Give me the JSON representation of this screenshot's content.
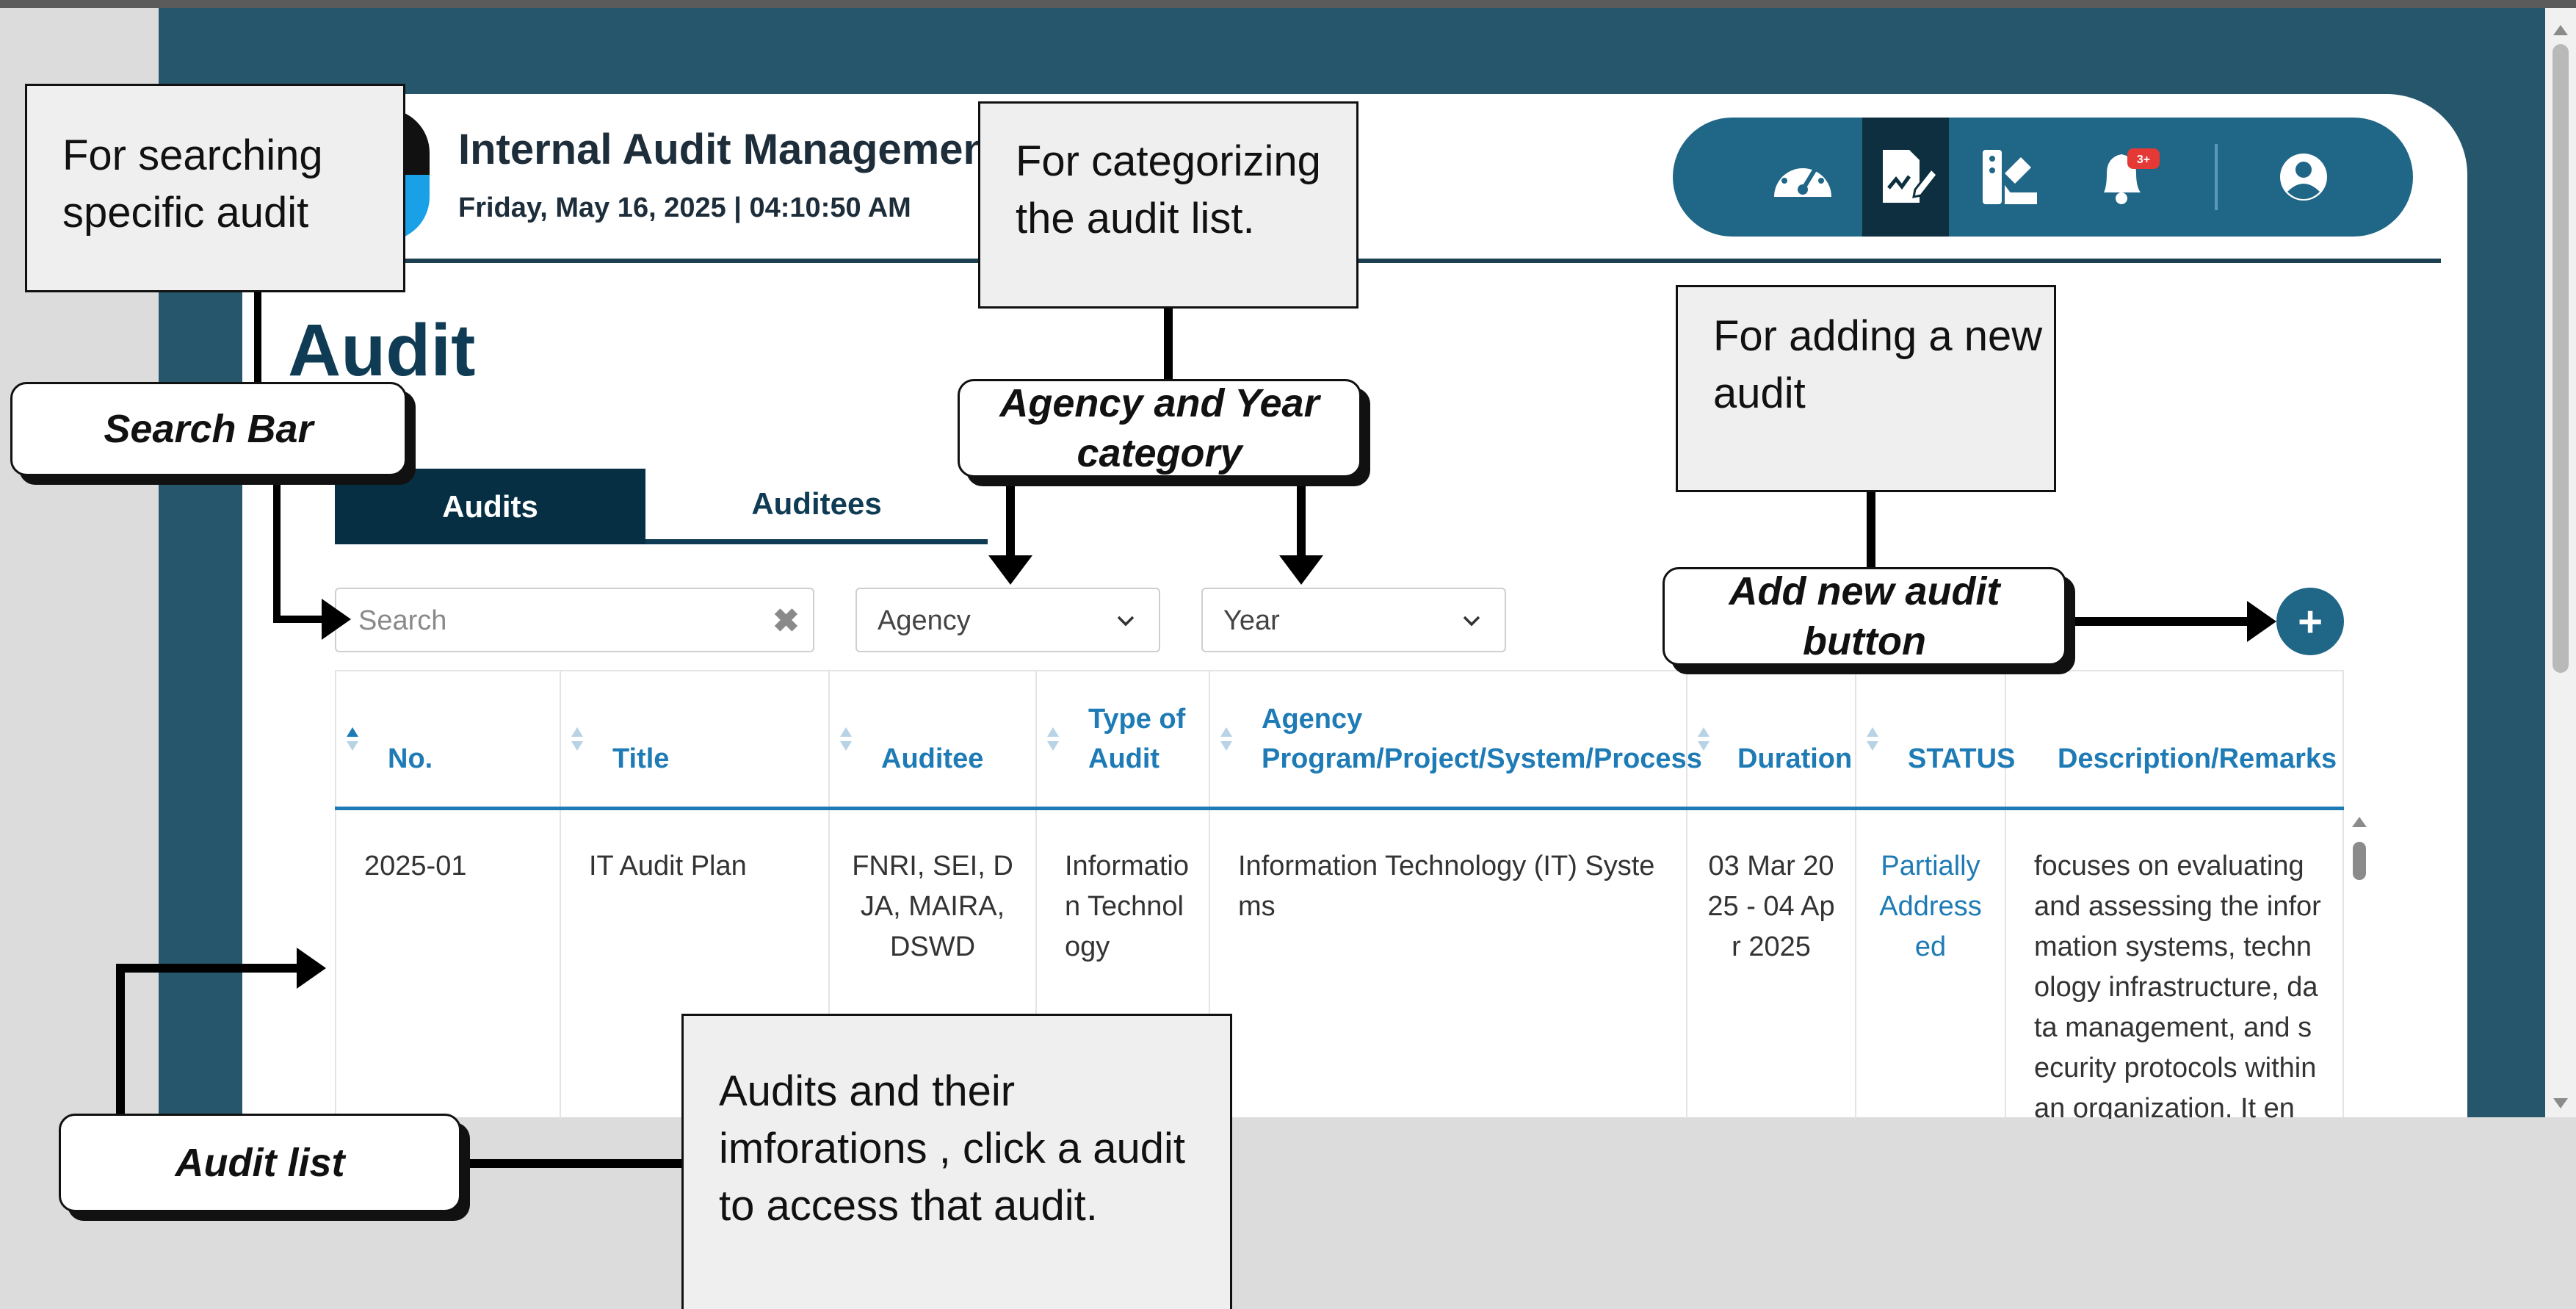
{
  "header": {
    "app_title": "Internal Audit Managemen",
    "date_time": "Friday, May 16, 2025 | 04:10:50 AM",
    "nav_icons": [
      "dashboard-icon",
      "audit-edit-icon",
      "reports-icon",
      "notification-bell-icon",
      "user-account-icon"
    ],
    "notification_badge": "3+"
  },
  "page": {
    "heading": "Audit"
  },
  "tabs": [
    {
      "label": "Audits",
      "active": true
    },
    {
      "label": "Auditees",
      "active": false
    }
  ],
  "filters": {
    "search_placeholder": "Search",
    "agency_label": "Agency",
    "year_label": "Year",
    "add_label": "+"
  },
  "table": {
    "columns": [
      "No.",
      "Title",
      "Auditee",
      "Type of Audit",
      "Agency Program/Project/System/Process",
      "Duration",
      "STATUS",
      "Description/Remarks"
    ],
    "rows": [
      {
        "no": "2025-01",
        "title": "IT Audit Plan",
        "auditee": "FNRI, SEI, DJA, MAIRA, DSWD",
        "type": "Information Technology",
        "agency_program": "Information Technology (IT) Systems",
        "duration": "03 Mar 2025 - 04 Apr 2025",
        "status": "Partially Addressed",
        "description": "focuses on evaluating and assessing the information systems, technology infrastructure, data management, and security protocols within an organization. It en"
      }
    ]
  },
  "annotations": {
    "search_note": "For searching specific audit",
    "search_tag": "Search Bar",
    "category_note": "For categorizing the audit list.",
    "category_tag": "Agency and Year category",
    "add_note": "For adding a new audit",
    "add_tag": "Add new audit button",
    "list_tag": "Audit list",
    "list_note": "Audits and their imforations , click a audit to access that audit."
  },
  "colors": {
    "frame": "#25566b",
    "accent": "#1f6687",
    "dark": "#062f44",
    "link": "#1e7bb5",
    "badge": "#e53935"
  }
}
